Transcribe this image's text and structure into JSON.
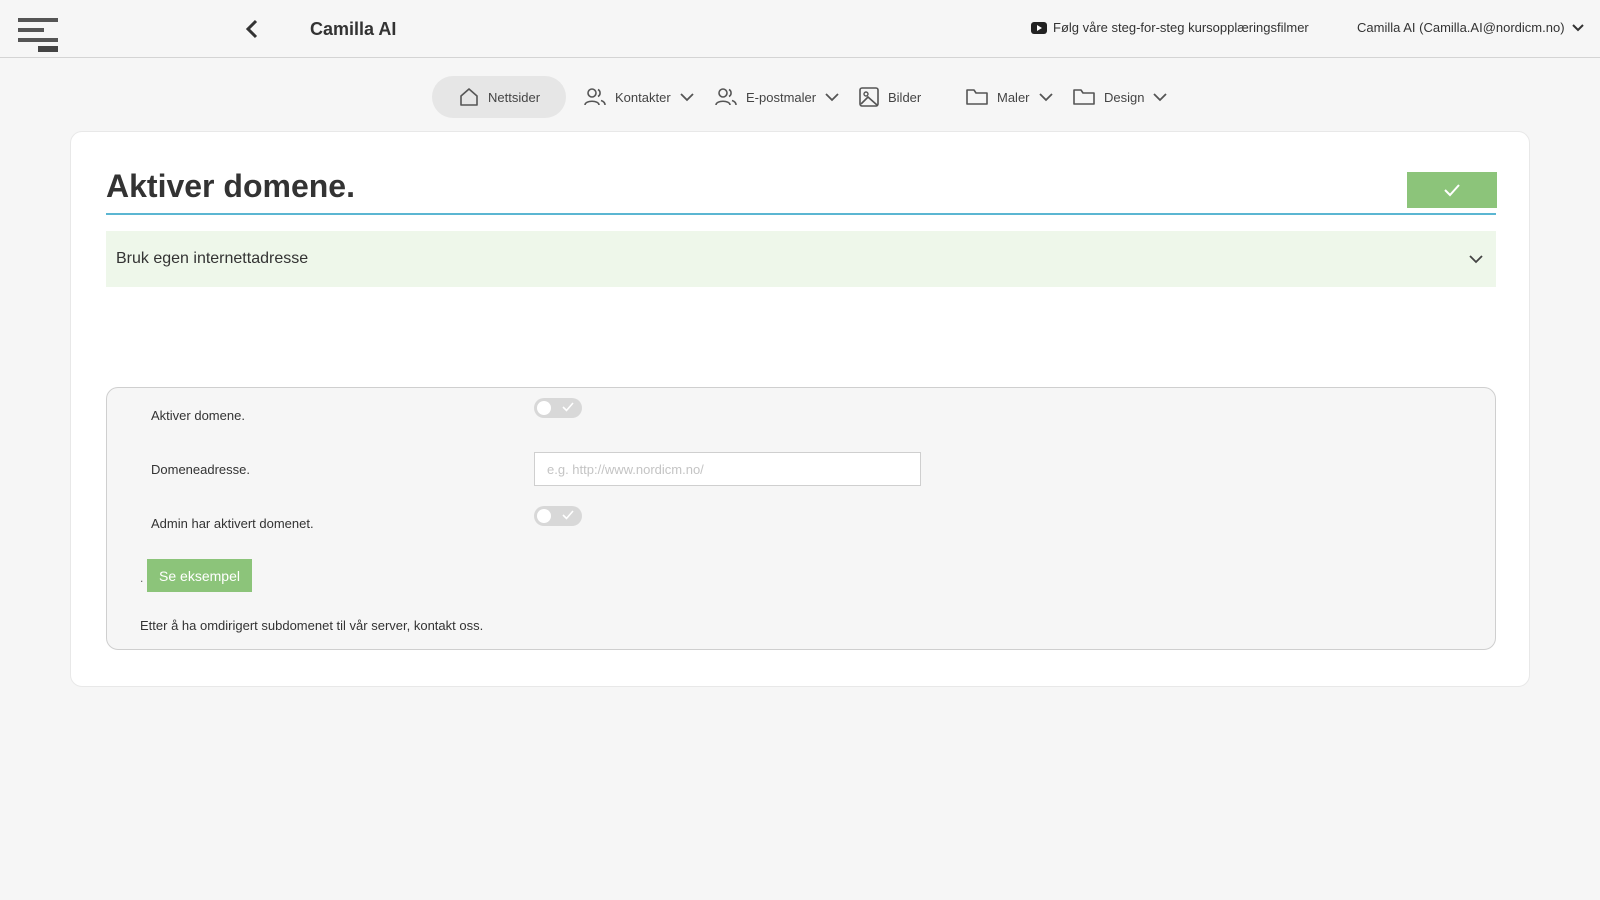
{
  "header": {
    "app_title": "Camilla AI",
    "tutorial_link": "Følg våre steg-for-steg kursopplæringsfilmer",
    "user_menu": "Camilla AI (Camilla.AI@nordicm.no)"
  },
  "nav": {
    "items": [
      {
        "label": "Nettsider",
        "icon": "home-icon",
        "active": true
      },
      {
        "label": "Kontakter",
        "icon": "users-icon",
        "dropdown": true
      },
      {
        "label": "E-postmaler",
        "icon": "users-icon",
        "dropdown": true
      },
      {
        "label": "Bilder",
        "icon": "image-icon"
      },
      {
        "label": "Maler",
        "icon": "folder-icon",
        "dropdown": true
      },
      {
        "label": "Design",
        "icon": "folder-icon",
        "dropdown": true
      }
    ]
  },
  "page": {
    "title": "Aktiver domene.",
    "accordion_label": "Bruk egen internettadresse"
  },
  "form": {
    "activate_label": "Aktiver domene.",
    "activate_on": false,
    "domain_label": "Domeneadresse.",
    "domain_value": "",
    "domain_placeholder": "e.g. http://www.nordicm.no/",
    "admin_label": "Admin har aktivert domenet.",
    "admin_on": false,
    "dot": ".",
    "example_button": "Se eksempel",
    "footnote": "Etter å ha omdirigert subdomenet til vår server, kontakt oss."
  },
  "colors": {
    "accent_green": "#8cc47a",
    "accordion_bg": "#eef7ea",
    "title_rule": "#5bb6d2",
    "page_bg": "#f6f6f6"
  }
}
